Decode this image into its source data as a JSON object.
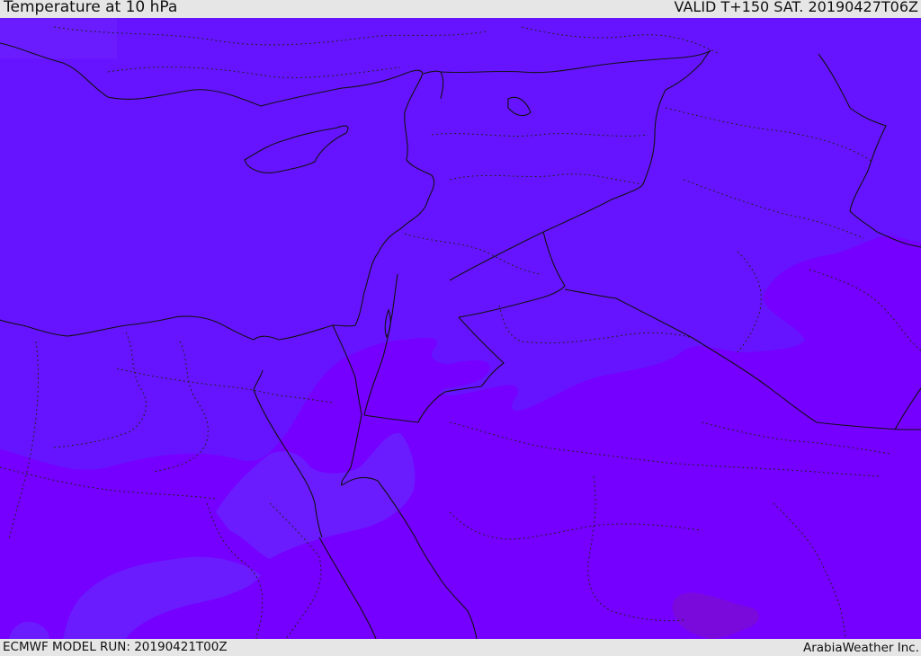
{
  "header": {
    "title": "Temperature at 10 hPa",
    "valid": "VALID T+150 SAT. 20190427T06Z"
  },
  "footer": {
    "model_run": "ECMWF MODEL RUN: 20190421T00Z",
    "credit": "ArabiaWeather Inc."
  },
  "colors": {
    "band_warm": "#6614ff",
    "band_mid": "#7600ff",
    "band_cold": "#7a0adc",
    "band_light": "#6a1cff",
    "boundaries": "#111111"
  }
}
